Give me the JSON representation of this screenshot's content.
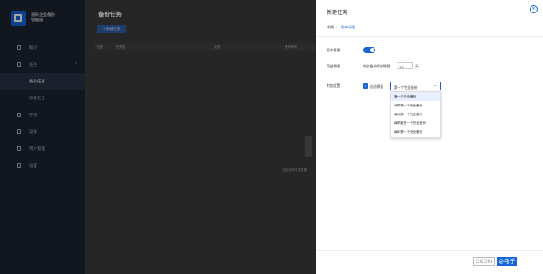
{
  "brand": {
    "line1": "迪肯企业备份",
    "line2": "管理版"
  },
  "sidebar": {
    "items": [
      {
        "label": "概况",
        "icon": "dashboard-icon"
      },
      {
        "label": "任务",
        "icon": "task-icon"
      },
      {
        "label": "备份任务",
        "sub": true,
        "active": true
      },
      {
        "label": "恢复任务",
        "sub": true
      },
      {
        "label": "存储",
        "icon": "storage-icon"
      },
      {
        "label": "设备",
        "icon": "device-icon"
      },
      {
        "label": "用户管理",
        "icon": "users-icon"
      },
      {
        "label": "设置",
        "icon": "gear-icon"
      }
    ]
  },
  "main": {
    "title": "备份任务",
    "new_button": "+ 新建任务",
    "columns": [
      "类型",
      "任务名",
      "状态",
      "备份时间"
    ],
    "empty_text": "当前没有任务数据"
  },
  "drawer": {
    "title": "新建任务",
    "breadcrumb": {
      "step1": "详情",
      "sep": "›",
      "step2": "版本清理"
    },
    "version_cleanup_label": "版本清理",
    "retention_label": "保留期限",
    "retention_text": "完全备份保留期限:",
    "retention_value": "10",
    "retention_unit": "天",
    "extra_label": "附加设置",
    "auto_keep_label": "自动保留",
    "select_value": "第一个完全备份",
    "options": [
      "第一个完全备份",
      "每周第一个完全备份",
      "每月第一个完全备份",
      "每季度第一个完全备份",
      "每年第一个完全备份"
    ]
  },
  "watermark": {
    "part1": "CSDN",
    "part2": "@电手"
  }
}
